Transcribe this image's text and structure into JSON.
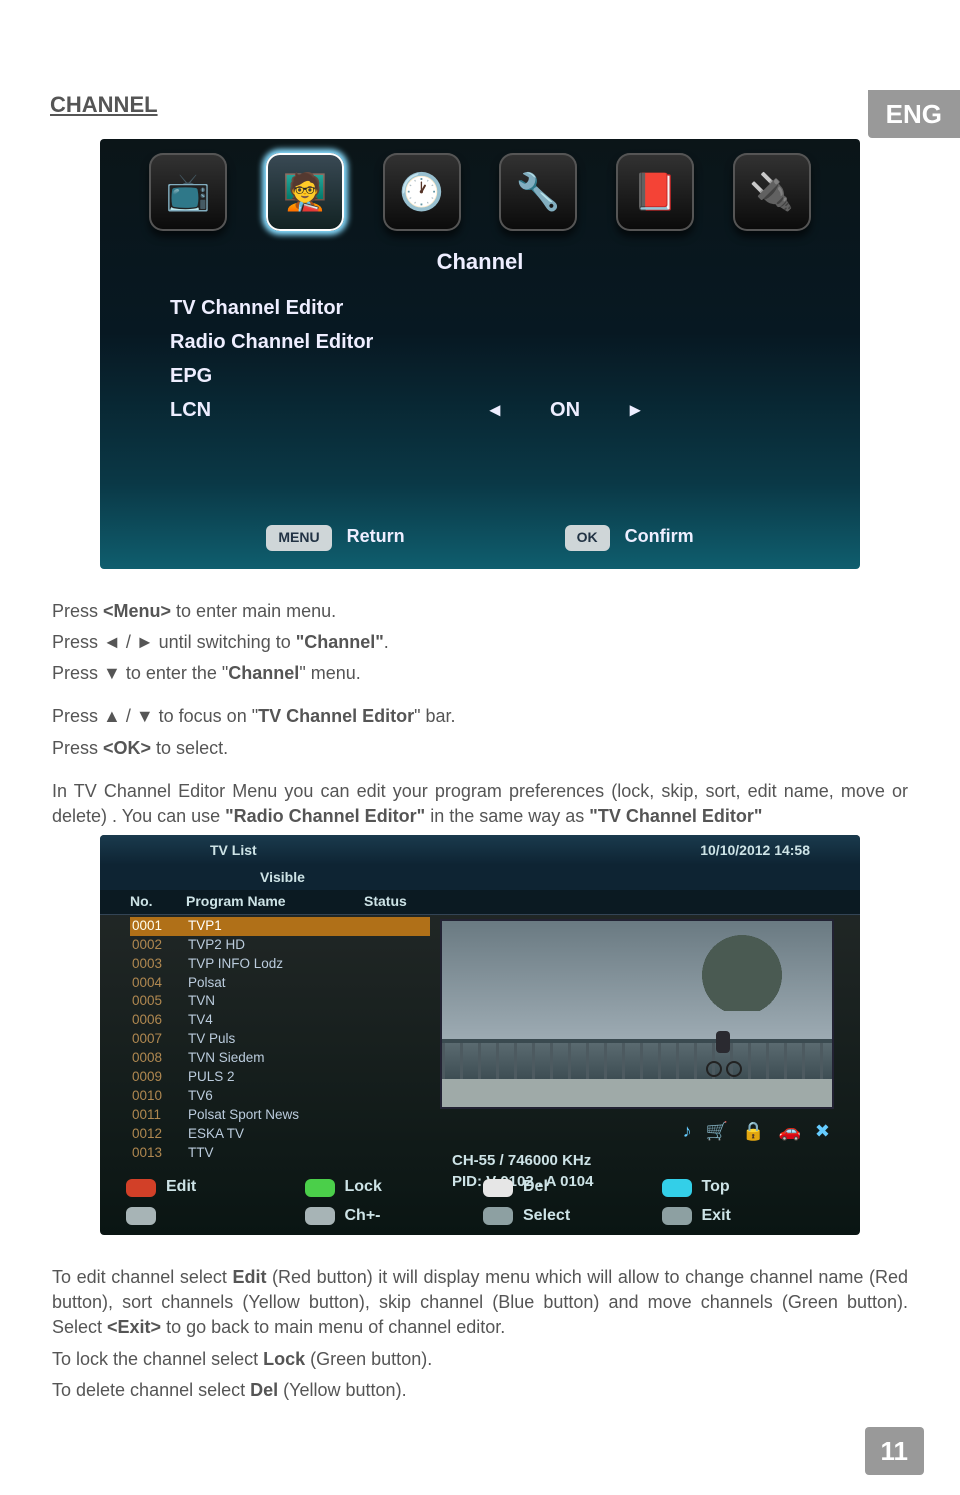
{
  "lang_tab": "ENG",
  "section_title": "CHANNEL",
  "page_num": "11",
  "shot1": {
    "title": "Channel",
    "items": [
      "TV Channel Editor",
      "Radio Channel Editor",
      "EPG",
      "LCN"
    ],
    "lcn_value": "ON",
    "footer": {
      "menu_btn": "MENU",
      "return": "Return",
      "ok_btn": "OK",
      "confirm": "Confirm"
    },
    "icons": [
      "📺",
      "🧑‍🏫",
      "🕐",
      "🔧",
      "📕",
      "🔌"
    ]
  },
  "text1": {
    "p1a": "Press ",
    "p1b": "<Menu>",
    "p1c": " to enter main menu.",
    "p2a": "Press ◄ / ► until switching to ",
    "p2b": "\"Channel\"",
    "p2c": ".",
    "p3a": "Press ▼ to enter the \"",
    "p3b": "Channel",
    "p3c": "\" menu.",
    "p4a": "Press ▲ / ▼ to focus on \"",
    "p4b": "TV Channel Editor",
    "p4c": "\" bar.",
    "p5a": "Press ",
    "p5b": "<OK>",
    "p5c": " to select.",
    "p6a": "In TV Channel Editor Menu you can edit  your program preferences (lock, skip, sort, edit name, move or delete) . You can use ",
    "p6b": "\"Radio Channel Editor\"",
    "p6c": " in the same way as ",
    "p6d": "\"TV Channel Editor\""
  },
  "shot2": {
    "header_left": "TV List",
    "header_right": "10/10/2012 14:58",
    "tab1": "Visible",
    "cols": {
      "no": "No.",
      "name": "Program Name",
      "status": "Status"
    },
    "rows": [
      {
        "no": "0001",
        "name": "TVP1"
      },
      {
        "no": "0002",
        "name": "TVP2 HD"
      },
      {
        "no": "0003",
        "name": "TVP INFO Lodz"
      },
      {
        "no": "0004",
        "name": "Polsat"
      },
      {
        "no": "0005",
        "name": "TVN"
      },
      {
        "no": "0006",
        "name": "TV4"
      },
      {
        "no": "0007",
        "name": "TV Puls"
      },
      {
        "no": "0008",
        "name": "TVN Siedem"
      },
      {
        "no": "0009",
        "name": "PULS 2"
      },
      {
        "no": "0010",
        "name": "TV6"
      },
      {
        "no": "0011",
        "name": "Polsat Sport News"
      },
      {
        "no": "0012",
        "name": "ESKA TV"
      },
      {
        "no": "0013",
        "name": "TTV"
      }
    ],
    "info1": "CH-55 / 746000 KHz",
    "info2": "PID: V 0102 . A 0104",
    "btns": {
      "edit": "Edit",
      "lock": "Lock",
      "del": "Del",
      "top": "Top",
      "chpm": "Ch+-",
      "select": "Select",
      "exit": "Exit"
    }
  },
  "text2": {
    "p1a": "To edit channel select ",
    "p1b": "Edit",
    "p1c": " (Red button) it will display menu which will allow to change channel name (Red button), sort channels (Yellow button), skip channel (Blue button) and move channels (Green button). Select ",
    "p1d": "<Exit>",
    "p1e": " to go back to main menu of channel editor.",
    "p2a": "To lock the channel select ",
    "p2b": "Lock",
    "p2c": " (Green button).",
    "p3a": "To delete channel select ",
    "p3b": "Del",
    "p3c": " (Yellow button)."
  }
}
